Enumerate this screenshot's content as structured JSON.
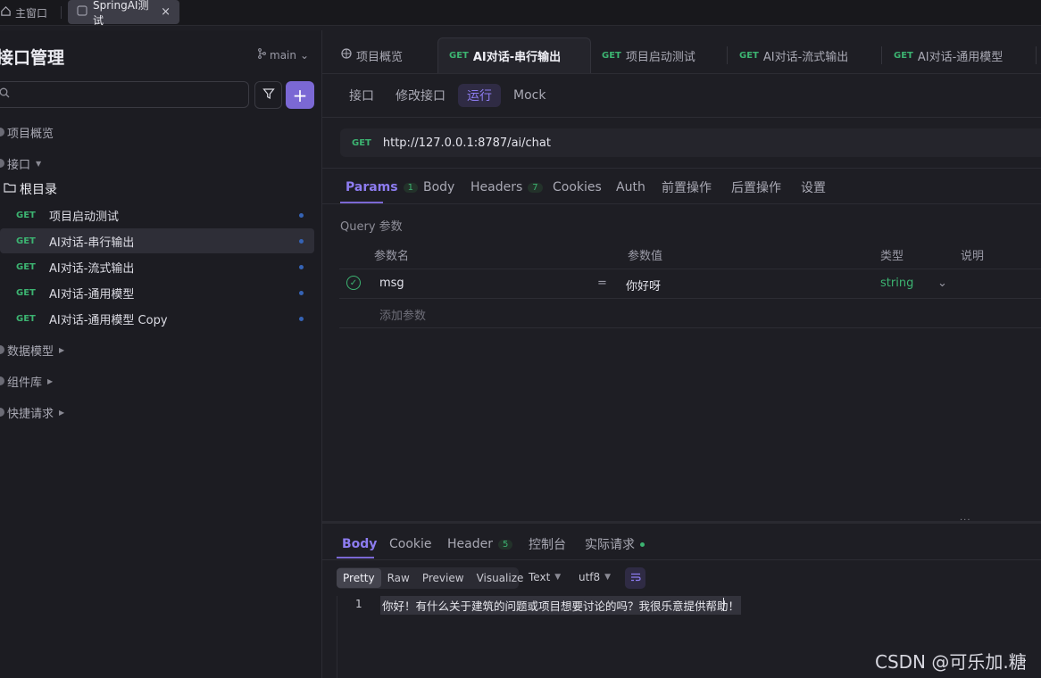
{
  "window": {
    "home_label": "主窗口",
    "tab_label": "SpringAI测试",
    "tab_close": "×"
  },
  "sidebar": {
    "title": "接口管理",
    "branch": "main",
    "search_placeholder": "",
    "add_label": "+",
    "overview": "项目概览",
    "apis_label": "接口",
    "root_folder": "根目录",
    "apis": [
      {
        "method": "GET",
        "name": "项目启动测试"
      },
      {
        "method": "GET",
        "name": "AI对话-串行输出"
      },
      {
        "method": "GET",
        "name": "AI对话-流式输出"
      },
      {
        "method": "GET",
        "name": "AI对话-通用模型"
      },
      {
        "method": "GET",
        "name": "AI对话-通用模型 Copy"
      }
    ],
    "models": "数据模型",
    "components": "组件库",
    "quick_requests": "快捷请求"
  },
  "tabs": [
    {
      "method": "",
      "label": "项目概览"
    },
    {
      "method": "GET",
      "label": "AI对话-串行输出"
    },
    {
      "method": "GET",
      "label": "项目启动测试"
    },
    {
      "method": "GET",
      "label": "AI对话-流式输出"
    },
    {
      "method": "GET",
      "label": "AI对话-通用模型"
    }
  ],
  "subtabs": [
    "接口",
    "修改接口",
    "运行",
    "Mock"
  ],
  "request": {
    "method": "GET",
    "url": "http://127.0.0.1:8787/ai/chat"
  },
  "param_tabs": [
    {
      "label": "Params",
      "count": "1"
    },
    {
      "label": "Body",
      "count": ""
    },
    {
      "label": "Headers",
      "count": "7"
    },
    {
      "label": "Cookies",
      "count": ""
    },
    {
      "label": "Auth",
      "count": ""
    },
    {
      "label": "前置操作",
      "count": ""
    },
    {
      "label": "后置操作",
      "count": ""
    },
    {
      "label": "设置",
      "count": ""
    }
  ],
  "query": {
    "section_label": "Query 参数",
    "headers": [
      "参数名",
      "参数值",
      "类型",
      "说明"
    ],
    "rows": [
      {
        "name": "msg",
        "eq": "=",
        "value": "你好呀",
        "type": "string"
      }
    ],
    "add_placeholder": "添加参数"
  },
  "response": {
    "tabs": [
      {
        "label": "Body",
        "count": ""
      },
      {
        "label": "Cookie",
        "count": ""
      },
      {
        "label": "Header",
        "count": "5"
      },
      {
        "label": "控制台",
        "count": ""
      },
      {
        "label": "实际请求",
        "count": ""
      }
    ],
    "view_modes": [
      "Pretty",
      "Raw",
      "Preview",
      "Visualize"
    ],
    "format": "Text",
    "encoding": "utf8",
    "line_number": "1",
    "body_text": "你好！有什么关于建筑的问题或项目想要讨论的吗？我很乐意提供帮助！"
  },
  "watermark": "CSDN @可乐加.糖",
  "colors": {
    "accent": "#7b68d4",
    "method_get": "#3cb371",
    "background": "#1e1e24"
  }
}
